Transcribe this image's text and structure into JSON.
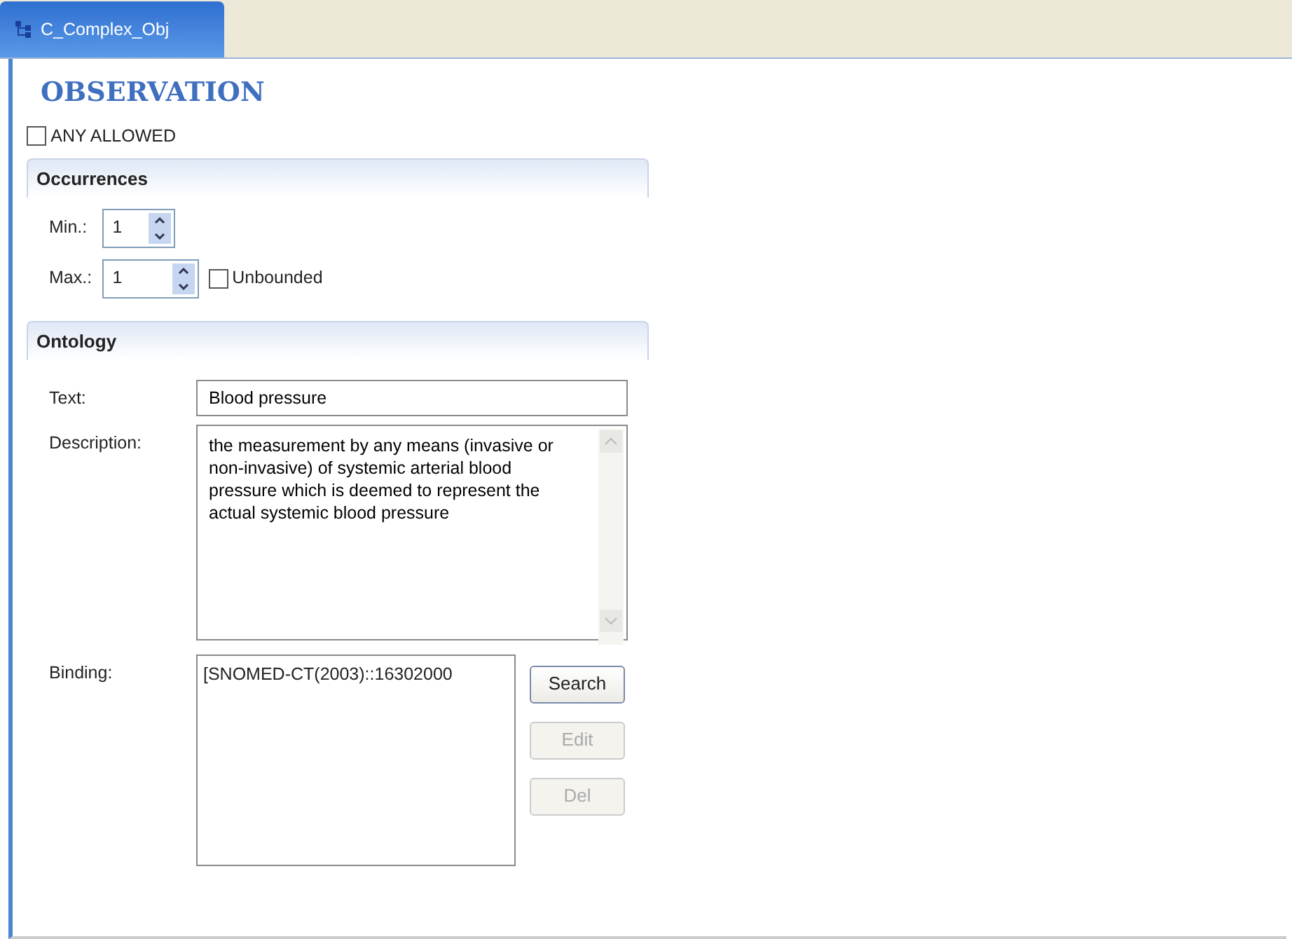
{
  "tab": {
    "label": "C_Complex_Obj",
    "selected": true
  },
  "title": "OBSERVATION",
  "any_allowed": {
    "label": "ANY ALLOWED",
    "checked": false
  },
  "occurrences": {
    "heading": "Occurrences",
    "min": {
      "label": "Min.:",
      "value": "1"
    },
    "max": {
      "label": "Max.:",
      "value": "1"
    },
    "unbounded": {
      "label": "Unbounded",
      "checked": false
    }
  },
  "ontology": {
    "heading": "Ontology",
    "text": {
      "label": "Text:",
      "value": "Blood pressure"
    },
    "description": {
      "label": "Description:",
      "value": "the measurement by any means (invasive or non-invasive) of systemic arterial blood pressure which is deemed to represent the actual systemic blood pressure"
    },
    "binding": {
      "label": "Binding:",
      "items": [
        "[SNOMED-CT(2003)::16302000"
      ]
    },
    "buttons": [
      {
        "label": "Search",
        "disabled": false
      },
      {
        "label": "Edit",
        "disabled": true
      },
      {
        "label": "Del",
        "disabled": true
      }
    ]
  }
}
